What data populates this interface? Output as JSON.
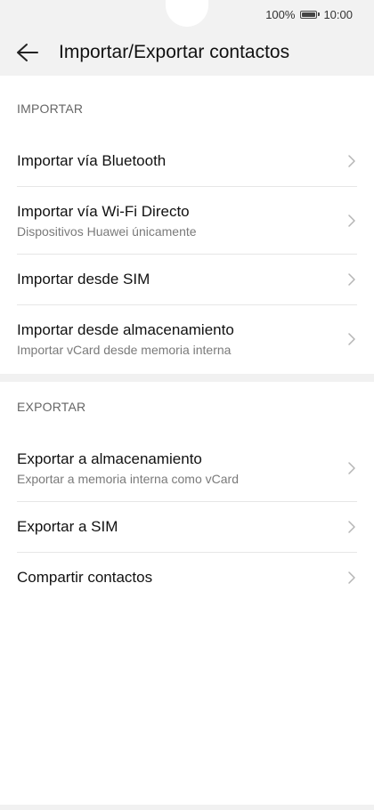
{
  "status_bar": {
    "battery_percent": "100%",
    "time": "10:00"
  },
  "app_bar": {
    "title": "Importar/Exportar contactos",
    "back_icon": "arrow-left-icon"
  },
  "import_section": {
    "header": "IMPORTAR",
    "items": [
      {
        "label": "Importar vía Bluetooth",
        "subtitle": ""
      },
      {
        "label": "Importar vía Wi-Fi Directo",
        "subtitle": "Dispositivos Huawei únicamente"
      },
      {
        "label": "Importar desde SIM",
        "subtitle": ""
      },
      {
        "label": "Importar desde almacenamiento",
        "subtitle": "Importar vCard desde memoria interna"
      }
    ]
  },
  "export_section": {
    "header": "EXPORTAR",
    "items": [
      {
        "label": "Exportar a almacenamiento",
        "subtitle": "Exportar a memoria interna como vCard"
      },
      {
        "label": "Exportar a SIM",
        "subtitle": ""
      },
      {
        "label": "Compartir contactos",
        "subtitle": ""
      }
    ]
  },
  "icons": {
    "chevron": "chevron-right-icon",
    "battery": "battery-icon"
  }
}
